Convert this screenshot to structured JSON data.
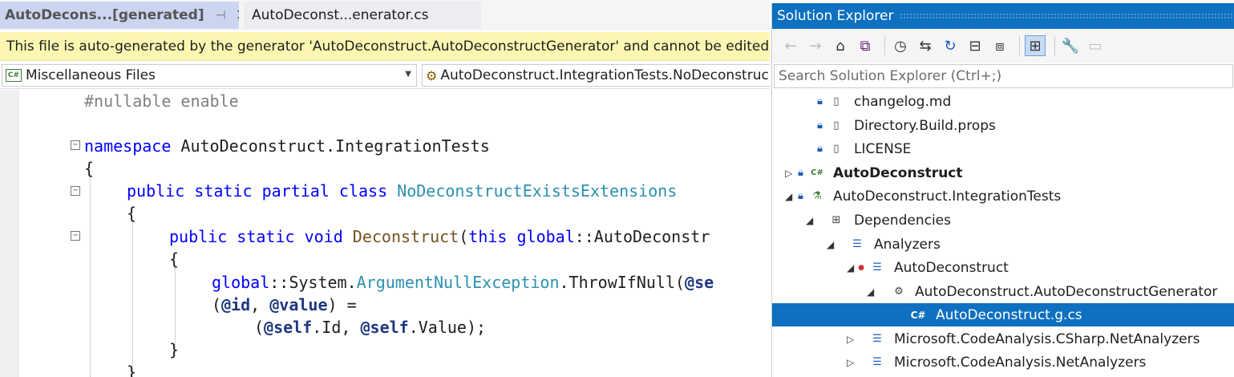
{
  "editor": {
    "tabs": [
      {
        "label": "AutoDecons...[generated]",
        "pin": "⊣",
        "close": "✕"
      },
      {
        "label": "AutoDeconst...enerator.cs"
      }
    ],
    "infobar": "This file is auto-generated by the generator 'AutoDeconstruct.AutoDeconstructGenerator' and cannot be edited.",
    "nav_project": "Miscellaneous Files",
    "nav_type": "AutoDeconstruct.IntegrationTests.NoDeconstruc",
    "code": {
      "l1": "#nullable enable",
      "l3_kw": "namespace",
      "l3_ns": " AutoDeconstruct.IntegrationTests",
      "l4": "{",
      "l5_kw": "public static partial class",
      "l5_ty": "NoDeconstructExistsExtensions",
      "l6": "{",
      "l7_kw": "public static void",
      "l7_me": "Deconstruct",
      "l7_p1": "(",
      "l7_kw2": "this global",
      "l7_rest": "::AutoDeconstr",
      "l8": "{",
      "l9_kw": "global",
      "l9_a": "::System.",
      "l9_ty": "ArgumentNullException",
      "l9_b": ".ThrowIfNull(",
      "l9_id": "@se",
      "l10_a": "(",
      "l10_id1": "@id",
      "l10_b": ", ",
      "l10_id2": "@value",
      "l10_c": ") =",
      "l11_a": "(",
      "l11_id1": "@self",
      "l11_b": ".Id, ",
      "l11_id2": "@self",
      "l11_c": ".Value);",
      "l12": "}",
      "l13": "}"
    }
  },
  "solution_explorer": {
    "title": "Solution Explorer",
    "search_placeholder": "Search Solution Explorer (Ctrl+;)",
    "items": [
      {
        "label": "changelog.md"
      },
      {
        "label": "Directory.Build.props"
      },
      {
        "label": "LICENSE"
      },
      {
        "label": "AutoDeconstruct"
      },
      {
        "label": "AutoDeconstruct.IntegrationTests"
      },
      {
        "label": "Dependencies"
      },
      {
        "label": "Analyzers"
      },
      {
        "label": "AutoDeconstruct"
      },
      {
        "label": "AutoDeconstruct.AutoDeconstructGenerator"
      },
      {
        "label": "AutoDeconstruct.g.cs"
      },
      {
        "label": "Microsoft.CodeAnalysis.CSharp.NetAnalyzers"
      },
      {
        "label": "Microsoft.CodeAnalysis.NetAnalyzers"
      }
    ]
  },
  "colors": {
    "accent": "#0e70c0",
    "infobar": "#fbf7b2",
    "keyword": "#0000ff",
    "type": "#2b91af"
  }
}
